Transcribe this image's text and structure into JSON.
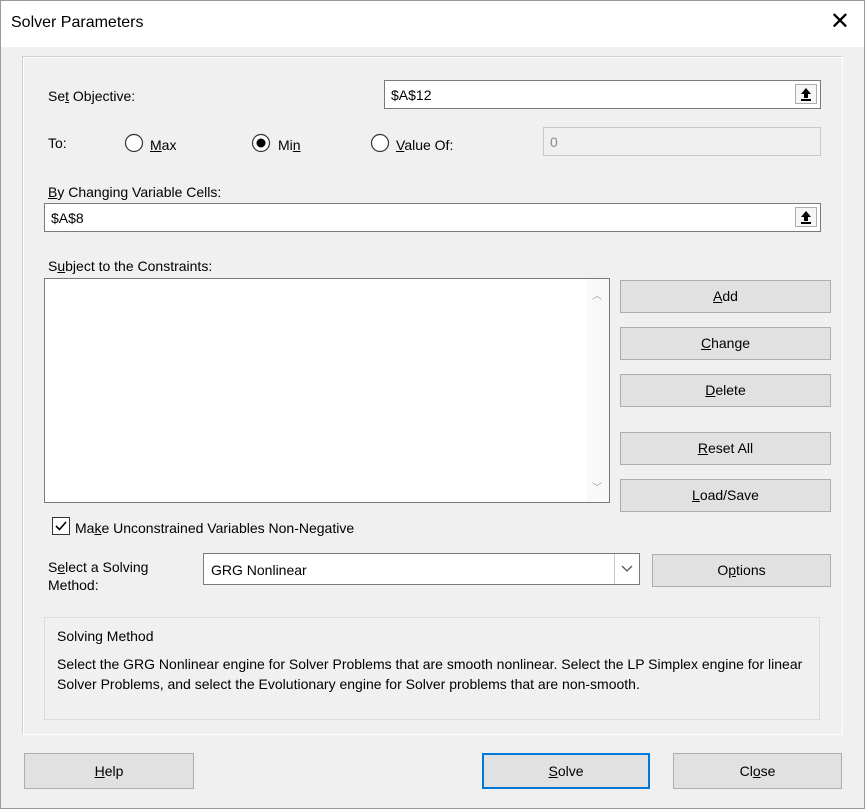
{
  "window": {
    "title": "Solver Parameters",
    "close": "✕"
  },
  "objective": {
    "label_pre": "Se",
    "label_u": "t",
    "label_post": " Objective:",
    "value": "$A$12"
  },
  "to": {
    "label": "To:",
    "max": {
      "label_u": "M",
      "label_post": "ax",
      "selected": false
    },
    "min": {
      "label_pre": "Mi",
      "label_u": "n",
      "selected": true
    },
    "value_of": {
      "label_u": "V",
      "label_post": "alue Of:",
      "selected": false,
      "value": "0"
    }
  },
  "changing": {
    "label_u": "B",
    "label_post": "y Changing Variable Cells:",
    "value": "$A$8"
  },
  "constraints": {
    "label_pre": "S",
    "label_u": "u",
    "label_post": "bject to the Constraints:",
    "items": []
  },
  "buttons": {
    "add": {
      "u": "A",
      "rest": "dd"
    },
    "change": {
      "u": "C",
      "rest": "hange"
    },
    "delete": {
      "u": "D",
      "rest": "elete"
    },
    "reset": {
      "u": "R",
      "rest": "eset All"
    },
    "loadsave": {
      "u": "L",
      "rest": "oad/Save"
    },
    "options": {
      "pre": "O",
      "u": "p",
      "rest": "tions"
    },
    "help": {
      "u": "H",
      "rest": "elp"
    },
    "solve": {
      "u": "S",
      "rest": "olve"
    },
    "close": {
      "pre": "Cl",
      "u": "o",
      "rest": "se"
    }
  },
  "nonneg": {
    "label_pre": "Ma",
    "label_u": "k",
    "label_post": "e Unconstrained Variables Non-Negative",
    "checked": true
  },
  "method": {
    "label_pre": "S",
    "label_u": "e",
    "label_post": "lect a Solving",
    "label_line2": "Method:",
    "selected": "GRG Nonlinear"
  },
  "info": {
    "title": "Solving Method",
    "text": "Select the GRG Nonlinear engine for Solver Problems that are smooth nonlinear. Select the LP Simplex engine for linear Solver Problems, and select the Evolutionary engine for Solver problems that are non-smooth."
  },
  "colors": {
    "accent": "#0078d7",
    "button": "#e1e1e1"
  }
}
